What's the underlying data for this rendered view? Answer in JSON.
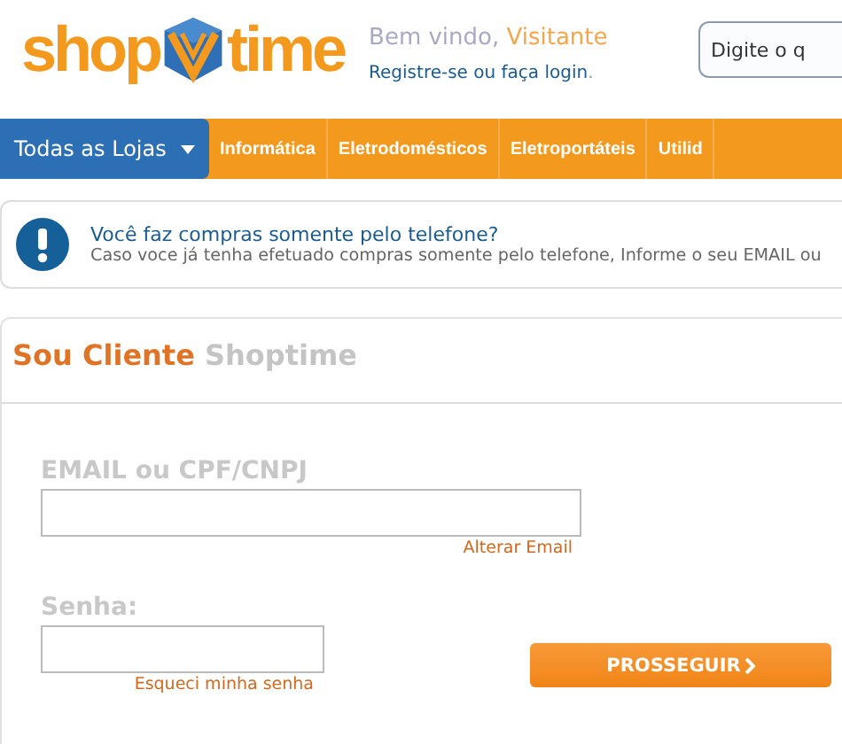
{
  "header": {
    "logo": {
      "left": "shop",
      "right": "time"
    },
    "greeting": {
      "prefix": "Bem vindo,",
      "name": "Visitante"
    },
    "register_link": "Registre-se ou faça login",
    "register_suffix": ".",
    "search": {
      "placeholder": "Digite o q"
    }
  },
  "nav": [
    {
      "label": "Todas as Lojas",
      "selected": true,
      "dropdown": true
    },
    {
      "label": "Informática",
      "selected": false,
      "dropdown": false
    },
    {
      "label": "Eletrodomésticos",
      "selected": false,
      "dropdown": false
    },
    {
      "label": "Eletroportáteis",
      "selected": false,
      "dropdown": false
    },
    {
      "label": "Utilid",
      "selected": false,
      "dropdown": false
    }
  ],
  "notice": {
    "title": "Você faz compras somente pelo telefone?",
    "text": "Caso voce já tenha efetuado compras somente pelo telefone, Informe o seu EMAIL ou"
  },
  "login": {
    "title": "Sou Cliente",
    "title_brand": "Shoptime",
    "email_label": "EMAIL ou CPF/CNPJ",
    "change_email": "Alterar Email",
    "password_label": "Senha:",
    "forgot": "Esqueci minha senha",
    "submit": "PROSSEGUIR"
  }
}
